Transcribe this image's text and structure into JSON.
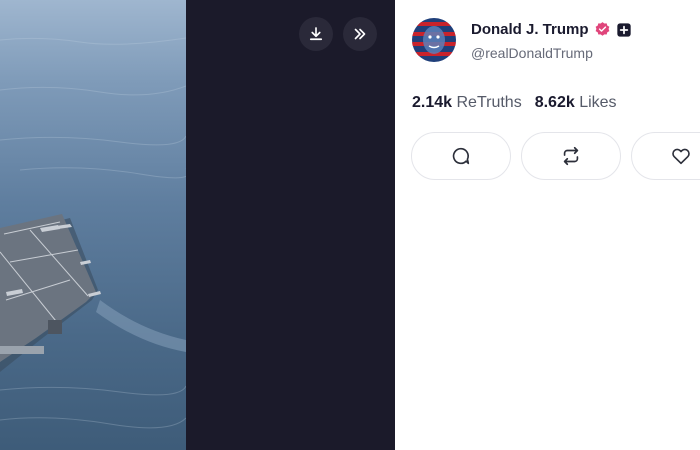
{
  "media": {
    "subject": "aircraft-carrier-photo"
  },
  "toolbar": {
    "download_icon": "download-icon",
    "expand_icon": "double-chevron-right-icon"
  },
  "profile": {
    "name": "Donald J. Trump",
    "handle": "@realDonaldTrump",
    "verified_icon": "verified-badge-icon",
    "verified_color": "#e0457b",
    "extra_badge_icon": "plus-square-icon"
  },
  "stats": {
    "retruths_count": "2.14k",
    "retruths_label": "ReTruths",
    "likes_count": "8.62k",
    "likes_label": "Likes"
  },
  "actions": [
    {
      "icon": "reply-icon"
    },
    {
      "icon": "retruth-icon"
    },
    {
      "icon": "heart-icon"
    }
  ],
  "colors": {
    "dark_band": "#1b1a2a",
    "text_primary": "#1a1a2e",
    "text_secondary": "#666a78"
  }
}
